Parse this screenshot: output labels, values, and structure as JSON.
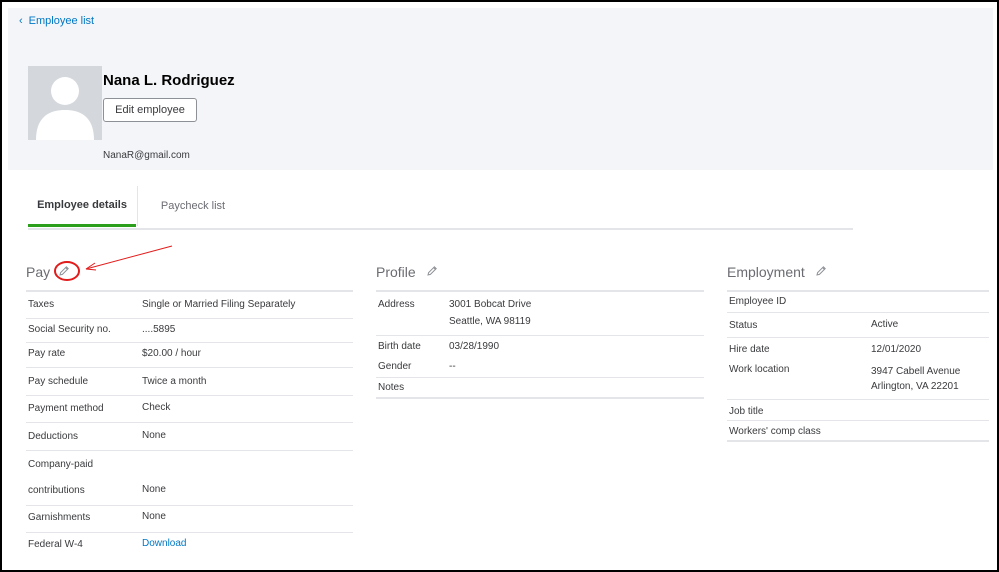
{
  "nav": {
    "back_label": "Employee list"
  },
  "employee": {
    "name": "Nana L. Rodriguez",
    "edit_label": "Edit employee",
    "email": "NanaR@gmail.com"
  },
  "tabs": [
    {
      "label": "Employee details",
      "active": true
    },
    {
      "label": "Paycheck list",
      "active": false
    }
  ],
  "pay": {
    "title": "Pay",
    "rows": [
      {
        "label": "Taxes",
        "value": "Single or Married Filing Separately"
      },
      {
        "label": "Social Security no.",
        "value": "....5895"
      },
      {
        "label": "Pay rate",
        "value": "$20.00 / hour"
      },
      {
        "label": "Pay schedule",
        "value": "Twice a month"
      },
      {
        "label": "Payment method",
        "value": "Check"
      },
      {
        "label": "Deductions",
        "value": "None"
      },
      {
        "label": "Company-paid",
        "value": ""
      },
      {
        "label": "contributions",
        "value": "None"
      },
      {
        "label": "Garnishments",
        "value": "None"
      },
      {
        "label": "Federal W-4",
        "value": "Download"
      }
    ]
  },
  "profile": {
    "title": "Profile",
    "rows": [
      {
        "label": "Address",
        "value": "3001 Bobcat Drive",
        "value2": "Seattle, WA 98119"
      },
      {
        "label": "Birth date",
        "value": "03/28/1990"
      },
      {
        "label": "Gender",
        "value": "--"
      },
      {
        "label": "Notes",
        "value": ""
      }
    ]
  },
  "employment": {
    "title": "Employment",
    "rows": [
      {
        "label": "Employee ID",
        "value": ""
      },
      {
        "label": "Status",
        "value": "Active"
      },
      {
        "label": "Hire date",
        "value": "12/01/2020"
      },
      {
        "label": "Work location",
        "value": "3947 Cabell Avenue",
        "value2": "Arlington, VA 22201"
      },
      {
        "label": "Job title",
        "value": ""
      },
      {
        "label": "Workers' comp class",
        "value": ""
      }
    ]
  },
  "colors": {
    "link": "#0077c5",
    "tab_active": "#2ca01c",
    "annotation": "#e21b1b"
  },
  "icons": {
    "pencil": "pencil-icon",
    "back": "chevron-left-icon",
    "avatar": "user-silhouette-icon"
  }
}
